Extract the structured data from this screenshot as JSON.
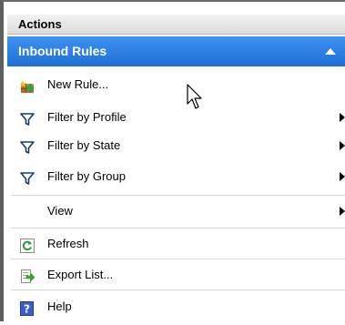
{
  "actions": {
    "title": "Actions"
  },
  "section": {
    "title": "Inbound Rules"
  },
  "items": [
    {
      "label": "New Rule...",
      "icon": "new-rule-icon",
      "submenu": false
    },
    {
      "label": "Filter by Profile",
      "icon": "filter-icon",
      "submenu": true
    },
    {
      "label": "Filter by State",
      "icon": "filter-icon",
      "submenu": true
    },
    {
      "label": "Filter by Group",
      "icon": "filter-icon",
      "submenu": true
    },
    {
      "label": "View",
      "icon": "",
      "submenu": true
    },
    {
      "label": "Refresh",
      "icon": "refresh-icon",
      "submenu": false
    },
    {
      "label": "Export List...",
      "icon": "export-icon",
      "submenu": false
    },
    {
      "label": "Help",
      "icon": "help-icon",
      "submenu": false
    }
  ],
  "colors": {
    "section_bg": "#2a7fe6",
    "header_bg": "#e6e6e6",
    "separator": "#d7d7d7"
  }
}
